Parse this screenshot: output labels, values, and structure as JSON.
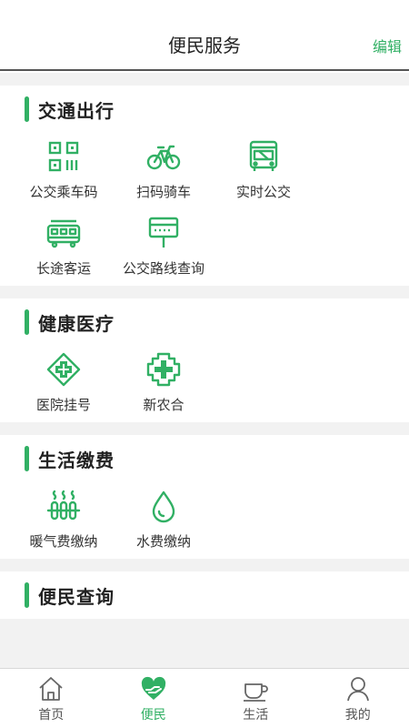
{
  "header": {
    "title": "便民服务",
    "edit_label": "编辑"
  },
  "sections": [
    {
      "title": "交通出行",
      "items": [
        {
          "label": "公交乘车码",
          "icon": "qr-code-icon"
        },
        {
          "label": "扫码骑车",
          "icon": "bicycle-icon"
        },
        {
          "label": "实时公交",
          "icon": "bus-icon"
        },
        {
          "label": "长途客运",
          "icon": "coach-icon"
        },
        {
          "label": "公交路线查询",
          "icon": "bus-stop-sign-icon"
        }
      ]
    },
    {
      "title": "健康医疗",
      "items": [
        {
          "label": "医院挂号",
          "icon": "medical-cross-icon"
        },
        {
          "label": "新农合",
          "icon": "insurance-cross-icon"
        }
      ]
    },
    {
      "title": "生活缴费",
      "items": [
        {
          "label": "暖气费缴纳",
          "icon": "radiator-icon"
        },
        {
          "label": "水费缴纳",
          "icon": "water-drop-icon"
        }
      ]
    },
    {
      "title": "便民查询",
      "items": []
    }
  ],
  "tabs": [
    {
      "label": "首页",
      "icon": "home-icon"
    },
    {
      "label": "便民",
      "icon": "heart-hand-icon"
    },
    {
      "label": "生活",
      "icon": "coffee-cup-icon"
    },
    {
      "label": "我的",
      "icon": "person-icon"
    }
  ],
  "colors": {
    "accent": "#31b064",
    "background": "#f2f2f2"
  },
  "active_tab": "便民"
}
